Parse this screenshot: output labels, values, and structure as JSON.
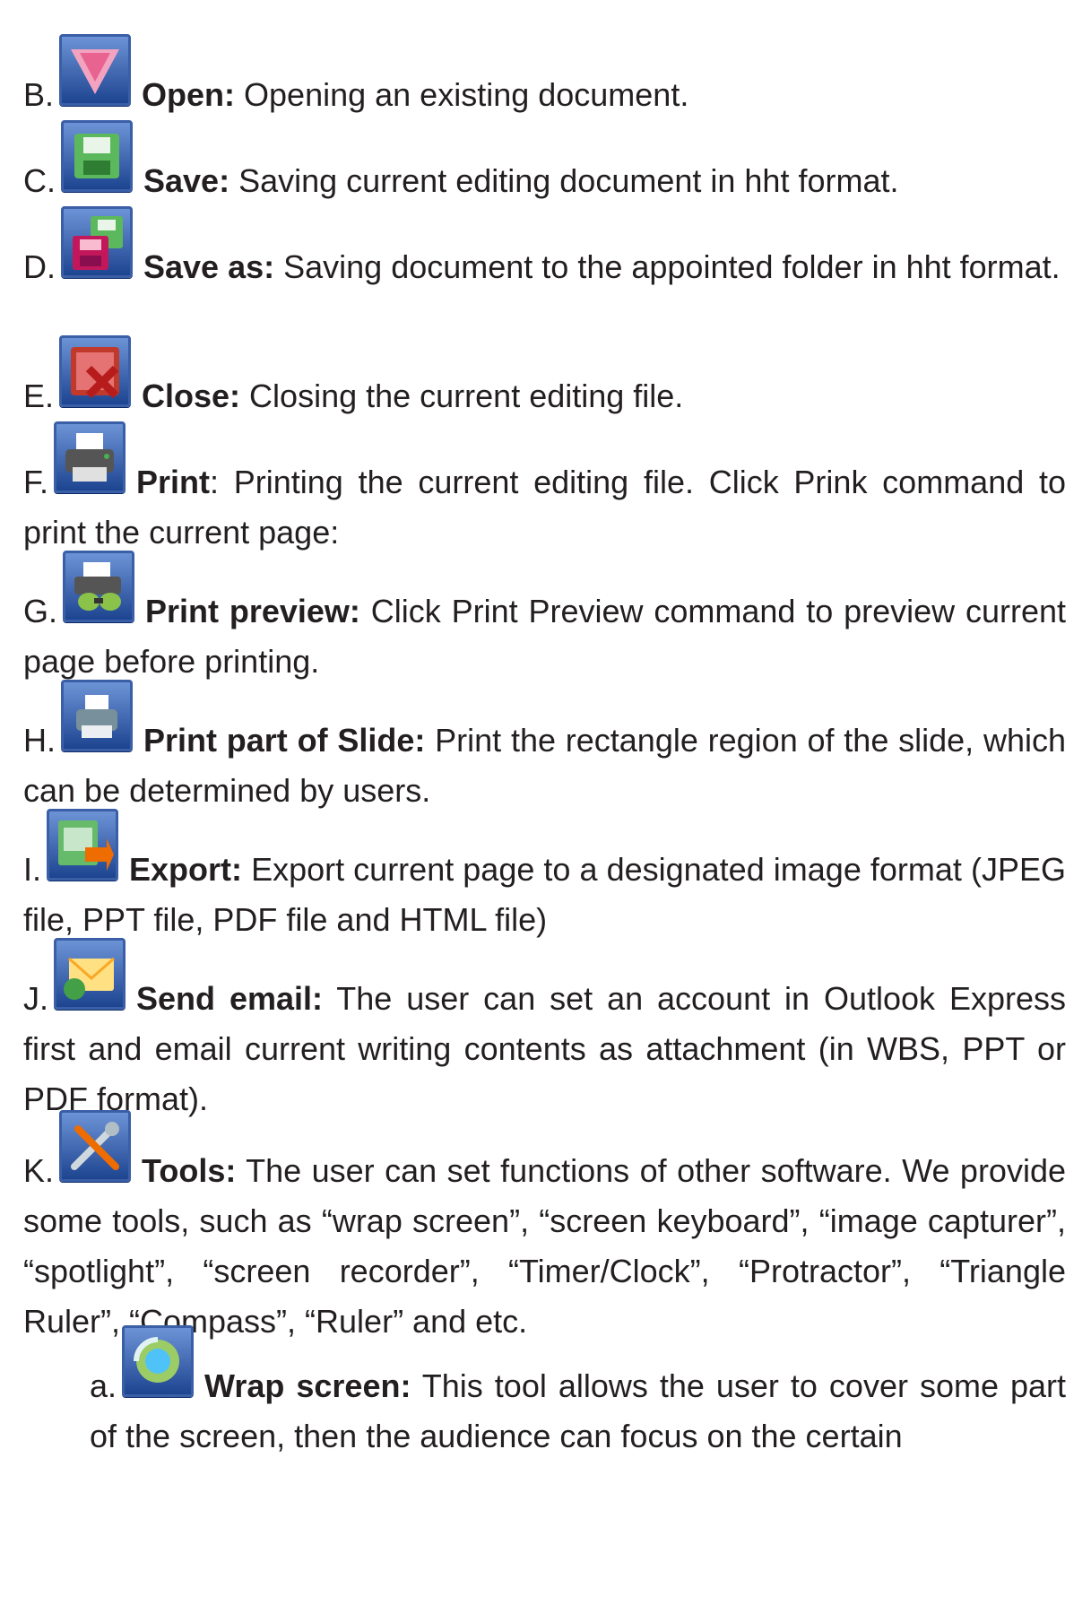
{
  "items": [
    {
      "letter": "B.",
      "icon": "open-icon",
      "title": "Open:",
      "text": " Opening an existing document."
    },
    {
      "letter": "C.",
      "icon": "save-icon",
      "title": "Save:",
      "text": " Saving current editing document in hht format."
    },
    {
      "letter": "D.",
      "icon": "save-as-icon",
      "title": "Save as:",
      "text": " Saving document to the appointed folder in hht format."
    },
    {
      "letter": "E.",
      "icon": "close-icon",
      "title": "Close:",
      "text": " Closing the current editing file."
    },
    {
      "letter": "F.",
      "icon": "print-icon",
      "title": "Print",
      "text": ": Printing the current editing file. Click Prink command to print the current page:"
    },
    {
      "letter": "G.",
      "icon": "print-preview-icon",
      "title": "Print preview:",
      "text": " Click Print Preview command to preview current page before printing."
    },
    {
      "letter": "H.",
      "icon": "print-part-of-slide-icon",
      "title": "Print part of Slide:",
      "text": " Print the rectangle region of the slide, which can be determined by users."
    },
    {
      "letter": "I.",
      "icon": "export-icon",
      "title": "Export:",
      "text": " Export current page to a designated image format (JPEG file, PPT file, PDF file and HTML file)"
    },
    {
      "letter": "J.",
      "icon": "send-email-icon",
      "title": "Send email:",
      "text": " The user can set an account in Outlook Express first and email current writing contents as attachment (in WBS, PPT or PDF format)."
    },
    {
      "letter": "K.",
      "icon": "tools-icon",
      "title": "Tools:",
      "text": " The user can set functions of other software. We provide some tools, such as “wrap screen”, “screen keyboard”, “image capturer”, “spotlight”, “screen recorder”, “Timer/Clock”, “Protractor”, “Triangle Ruler”, “Compass”, “Ruler” and etc."
    }
  ],
  "subitem": {
    "letter": "a.",
    "icon": "wrap-screen-icon",
    "title": "Wrap screen:",
    "text": " This tool allows the user to cover some part of the screen, then the audience can focus on the certain"
  }
}
